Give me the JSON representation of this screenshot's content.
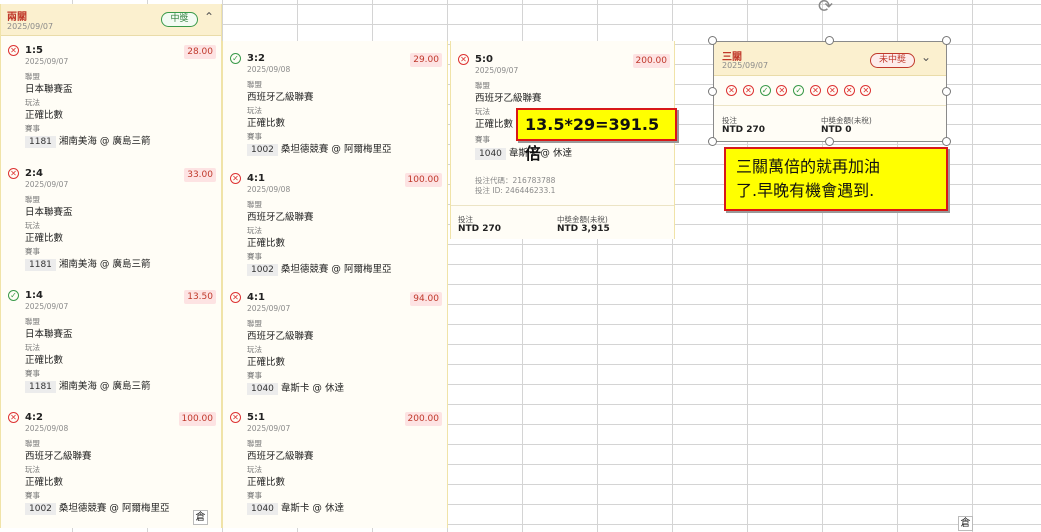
{
  "panel1": {
    "title": "兩關",
    "date": "2025/09/07",
    "badge": "中獎",
    "legs": [
      {
        "status": "lose",
        "score": "1:5",
        "date": "2025/09/07",
        "odds": "28.00",
        "league_label": "聯盟",
        "league": "日本聯賽盃",
        "play_label": "玩法",
        "play": "正確比數",
        "match_label": "賽事",
        "code": "1181",
        "match": "湘南美海 @ 廣島三箭"
      },
      {
        "status": "lose",
        "score": "2:4",
        "date": "2025/09/07",
        "odds": "33.00",
        "league_label": "聯盟",
        "league": "日本聯賽盃",
        "play_label": "玩法",
        "play": "正確比數",
        "match_label": "賽事",
        "code": "1181",
        "match": "湘南美海 @ 廣島三箭"
      },
      {
        "status": "win",
        "score": "1:4",
        "date": "2025/09/07",
        "odds": "13.50",
        "league_label": "聯盟",
        "league": "日本聯賽盃",
        "play_label": "玩法",
        "play": "正確比數",
        "match_label": "賽事",
        "code": "1181",
        "match": "湘南美海 @ 廣島三箭"
      },
      {
        "status": "lose",
        "score": "4:2",
        "date": "2025/09/08",
        "odds": "100.00",
        "league_label": "聯盟",
        "league": "西班牙乙級聯賽",
        "play_label": "玩法",
        "play": "正確比數",
        "match_label": "賽事",
        "code": "1002",
        "match": "桑坦德競賽 @ 阿爾梅里亞"
      }
    ]
  },
  "panel2": {
    "legs": [
      {
        "status": "win",
        "score": "3:2",
        "date": "2025/09/08",
        "odds": "29.00",
        "league_label": "聯盟",
        "league": "西班牙乙級聯賽",
        "play_label": "玩法",
        "play": "正確比數",
        "match_label": "賽事",
        "code": "1002",
        "match": "桑坦德競賽 @ 阿爾梅里亞"
      },
      {
        "status": "lose",
        "score": "4:1",
        "date": "2025/09/08",
        "odds": "100.00",
        "league_label": "聯盟",
        "league": "西班牙乙級聯賽",
        "play_label": "玩法",
        "play": "正確比數",
        "match_label": "賽事",
        "code": "1002",
        "match": "桑坦德競賽 @ 阿爾梅里亞"
      },
      {
        "status": "lose",
        "score": "4:1",
        "date": "2025/09/07",
        "odds": "94.00",
        "league_label": "聯盟",
        "league": "西班牙乙級聯賽",
        "play_label": "玩法",
        "play": "正確比數",
        "match_label": "賽事",
        "code": "1040",
        "match": "韋斯卡 @ 休達"
      },
      {
        "status": "lose",
        "score": "5:1",
        "date": "2025/09/07",
        "odds": "200.00",
        "league_label": "聯盟",
        "league": "西班牙乙級聯賽",
        "play_label": "玩法",
        "play": "正確比數",
        "match_label": "賽事",
        "code": "1040",
        "match": "韋斯卡 @ 休達"
      }
    ]
  },
  "panel3": {
    "leg": {
      "status": "lose",
      "score": "5:0",
      "date": "2025/09/07",
      "odds": "200.00",
      "league_label": "聯盟",
      "league": "西班牙乙級聯賽",
      "play_label": "玩法",
      "play": "正確比數",
      "match_label": "賽事",
      "code": "1040",
      "match": "韋斯卡 @ 休達"
    },
    "bet_code": "投注代碼：216783788",
    "bet_id": "投注 ID: 246446233.1",
    "stake_label": "投注",
    "stake": "NTD 270",
    "payout_label": "中獎金額(未稅)",
    "payout": "NTD 3,915"
  },
  "panel4": {
    "title": "三關",
    "date": "2025/09/07",
    "badge": "未中獎",
    "results": [
      "lose",
      "lose",
      "win",
      "lose",
      "win",
      "lose",
      "lose",
      "lose",
      "lose"
    ],
    "stake_label": "投注",
    "stake": "NTD 270",
    "payout_label": "中獎金額(未稅)",
    "payout": "NTD 0"
  },
  "annotations": {
    "calc": "13.5*29=391.5倍",
    "comment_line1": "三關萬倍的就再加油",
    "comment_line2": "了.早晚有機會遇到."
  },
  "icons": {
    "lose": "✕",
    "win": "✓",
    "chevron_up": "⌃",
    "chevron_down": "⌄",
    "rotate": "⟳",
    "paste": "倉"
  },
  "colors": {
    "lose": "#d33333",
    "win": "#3a9a4a",
    "highlight": "#ffff00",
    "callout_border": "#d81818"
  }
}
